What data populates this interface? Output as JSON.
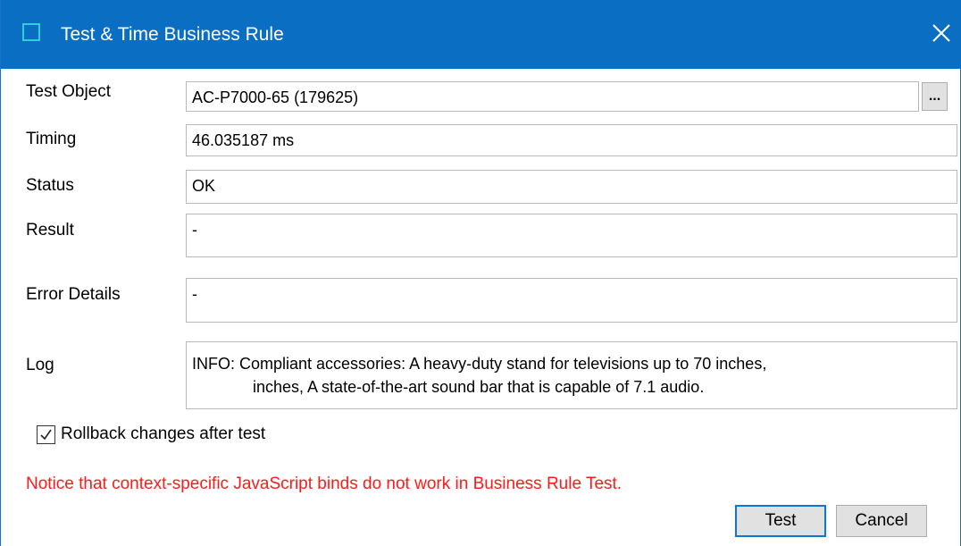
{
  "window": {
    "title": "Test & Time Business Rule",
    "close_symbol": "✕",
    "accent_color": "#0a6fc2"
  },
  "fields": {
    "test_object": {
      "label": "Test Object",
      "value": "AC-P7000-65 (179625)",
      "browse_label": "..."
    },
    "timing": {
      "label": "Timing",
      "value": "46.035187 ms"
    },
    "status": {
      "label": "Status",
      "value": "OK"
    },
    "result": {
      "label": "Result",
      "value": "-"
    },
    "error_details": {
      "label": "Error Details",
      "value": "-"
    },
    "log": {
      "label": "Log",
      "line1": "INFO: Compliant accessories: A heavy-duty stand for televisions up to 70 inches,",
      "line2": "inches, A state-of-the-art sound bar that is capable of 7.1 audio."
    }
  },
  "rollback": {
    "label": "Rollback changes after test",
    "checked": true
  },
  "notice": {
    "text": "Notice that context-specific JavaScript binds do not work in Business Rule Test.",
    "color": "#ff1a1a"
  },
  "buttons": {
    "test": "Test",
    "cancel": "Cancel"
  }
}
